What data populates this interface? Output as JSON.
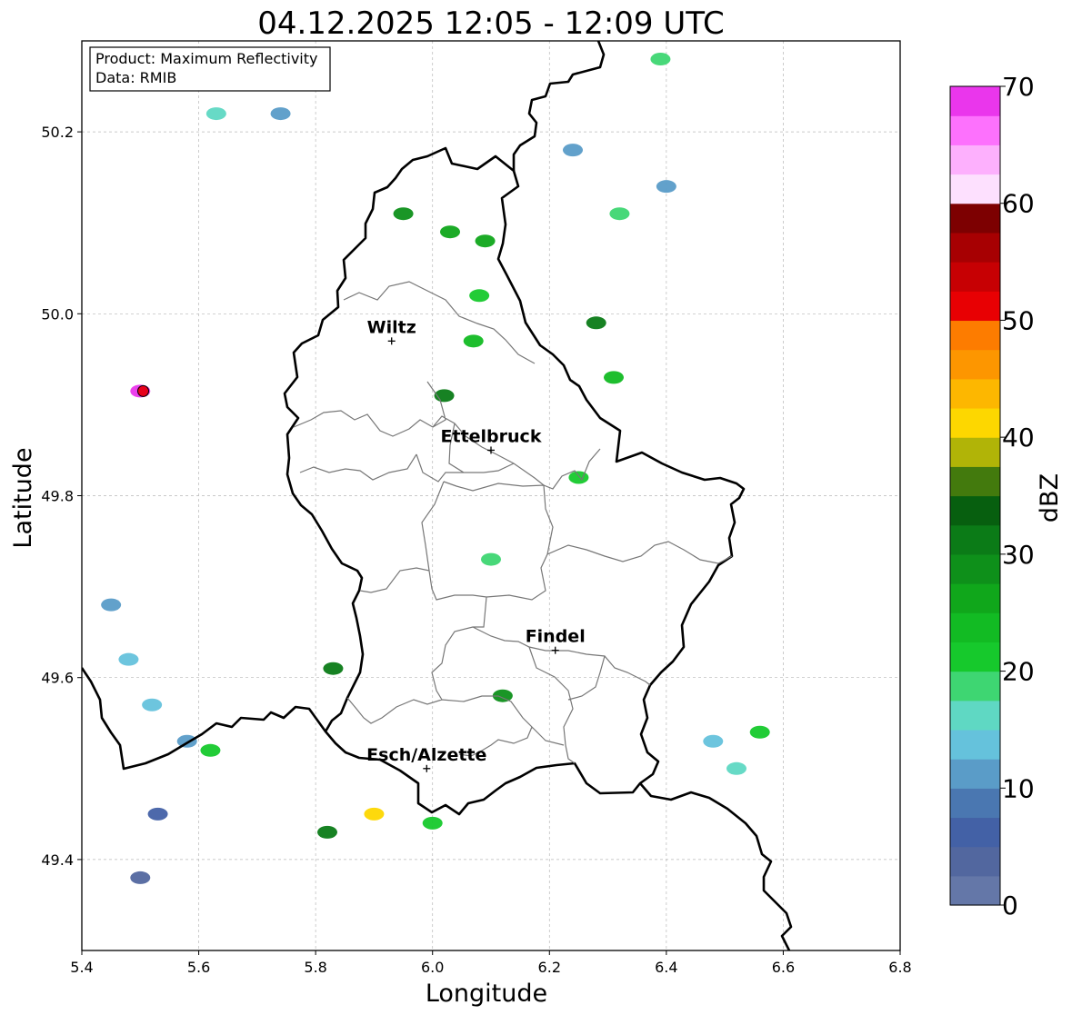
{
  "title": "04.12.2025 12:05 - 12:09 UTC",
  "info_box": {
    "product": "Product: Maximum Reflectivity",
    "data": "Data: RMIB"
  },
  "axes": {
    "xlabel": "Longitude",
    "ylabel": "Latitude",
    "xlim": [
      5.4,
      6.8
    ],
    "ylim": [
      49.3,
      50.3
    ],
    "xticks": [
      "5.4",
      "5.6",
      "5.8",
      "6.0",
      "6.2",
      "6.4",
      "6.6",
      "6.8"
    ],
    "yticks": [
      "49.4",
      "49.6",
      "49.8",
      "50.0",
      "50.2"
    ],
    "grid": true
  },
  "cities": [
    {
      "name": "Wiltz",
      "lon": 5.93,
      "lat": 49.97
    },
    {
      "name": "Ettelbruck",
      "lon": 6.1,
      "lat": 49.85
    },
    {
      "name": "Findel",
      "lon": 6.21,
      "lat": 49.63
    },
    {
      "name": "Esch/Alzette",
      "lon": 5.99,
      "lat": 49.5
    }
  ],
  "radar_site": {
    "lon": 5.505,
    "lat": 49.915,
    "color": "#e8001c"
  },
  "colorbar": {
    "label": "dBZ",
    "range": [
      0,
      70
    ],
    "ticks": [
      "0",
      "10",
      "20",
      "30",
      "40",
      "50",
      "60",
      "70"
    ],
    "colors": [
      "#6477a8",
      "#52679f",
      "#4361a6",
      "#4a77b1",
      "#5a9cc8",
      "#65c2dc",
      "#5fd8c3",
      "#3ed672",
      "#16c92c",
      "#12bb23",
      "#10a71b",
      "#0e901a",
      "#0b7b17",
      "#075f0f",
      "#437a0d",
      "#b1b407",
      "#fdd700",
      "#fdb700",
      "#fd9600",
      "#fd7c00",
      "#e80003",
      "#c70003",
      "#a70002",
      "#7d0001",
      "#fde0fe",
      "#fdb0fd",
      "#fd71fd",
      "#ea36ec"
    ]
  },
  "chart_data": {
    "type": "heatmap",
    "title": "04.12.2025 12:05 - 12:09 UTC",
    "xlabel": "Longitude",
    "ylabel": "Latitude",
    "xlim": [
      5.4,
      6.8
    ],
    "ylim": [
      49.3,
      50.3
    ],
    "value_label": "dBZ",
    "value_range": [
      0,
      70
    ],
    "echoes": [
      {
        "lon": 5.45,
        "lat": 49.68,
        "dbz": 12
      },
      {
        "lon": 5.48,
        "lat": 49.62,
        "dbz": 14
      },
      {
        "lon": 5.52,
        "lat": 49.57,
        "dbz": 13
      },
      {
        "lon": 5.58,
        "lat": 49.53,
        "dbz": 10
      },
      {
        "lon": 5.62,
        "lat": 49.52,
        "dbz": 22
      },
      {
        "lon": 5.53,
        "lat": 49.45,
        "dbz": 6
      },
      {
        "lon": 5.5,
        "lat": 49.38,
        "dbz": 4
      },
      {
        "lon": 5.82,
        "lat": 49.43,
        "dbz": 30
      },
      {
        "lon": 5.9,
        "lat": 49.45,
        "dbz": 40
      },
      {
        "lon": 6.0,
        "lat": 49.44,
        "dbz": 20
      },
      {
        "lon": 5.83,
        "lat": 49.61,
        "dbz": 30
      },
      {
        "lon": 6.12,
        "lat": 49.58,
        "dbz": 28
      },
      {
        "lon": 6.1,
        "lat": 49.73,
        "dbz": 19
      },
      {
        "lon": 6.25,
        "lat": 49.82,
        "dbz": 22
      },
      {
        "lon": 5.95,
        "lat": 50.11,
        "dbz": 28
      },
      {
        "lon": 6.03,
        "lat": 50.09,
        "dbz": 25
      },
      {
        "lon": 6.09,
        "lat": 50.08,
        "dbz": 26
      },
      {
        "lon": 6.08,
        "lat": 50.02,
        "dbz": 22
      },
      {
        "lon": 6.07,
        "lat": 49.97,
        "dbz": 24
      },
      {
        "lon": 6.02,
        "lat": 49.91,
        "dbz": 30
      },
      {
        "lon": 6.28,
        "lat": 49.99,
        "dbz": 31
      },
      {
        "lon": 6.31,
        "lat": 49.93,
        "dbz": 24
      },
      {
        "lon": 6.32,
        "lat": 50.11,
        "dbz": 18
      },
      {
        "lon": 6.39,
        "lat": 50.28,
        "dbz": 18
      },
      {
        "lon": 6.24,
        "lat": 50.18,
        "dbz": 10
      },
      {
        "lon": 6.4,
        "lat": 50.14,
        "dbz": 10
      },
      {
        "lon": 6.48,
        "lat": 49.53,
        "dbz": 14
      },
      {
        "lon": 6.52,
        "lat": 49.5,
        "dbz": 15
      },
      {
        "lon": 6.56,
        "lat": 49.54,
        "dbz": 20
      },
      {
        "lon": 5.63,
        "lat": 50.22,
        "dbz": 17
      },
      {
        "lon": 5.74,
        "lat": 50.22,
        "dbz": 10
      },
      {
        "lon": 5.5,
        "lat": 49.915,
        "dbz": 68
      }
    ]
  }
}
